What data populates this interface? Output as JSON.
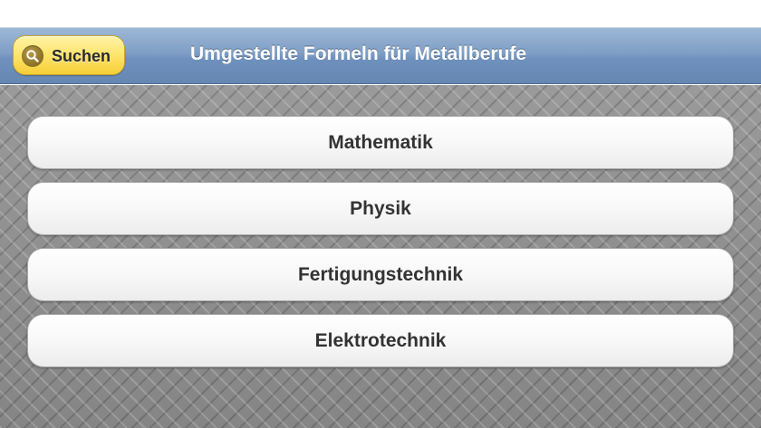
{
  "nav_bar": {
    "search_button_label": "Suchen",
    "title": "Umgestellte Formeln für Metallberufe"
  },
  "menu": {
    "items": [
      {
        "label": "Mathematik"
      },
      {
        "label": "Physik"
      },
      {
        "label": "Fertigungstechnik"
      },
      {
        "label": "Elektrotechnik"
      }
    ]
  },
  "colors": {
    "nav_bar": "#7f9fc6",
    "search_button": "#fde46b",
    "background": "#8e8e8e",
    "menu_item": "#f7f7f7",
    "menu_text": "#333333"
  }
}
